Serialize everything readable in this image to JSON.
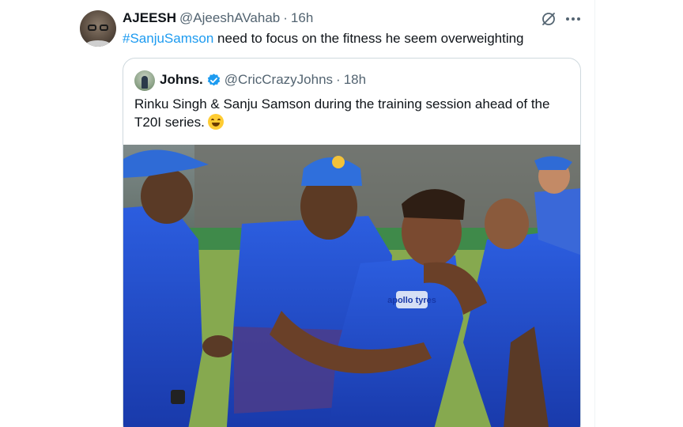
{
  "tweet": {
    "author_name": "AJEESH",
    "author_handle": "@AjeeshAVahab",
    "separator": "·",
    "time": "16h",
    "hashtag": "#SanjuSamson",
    "text": "need to focus on the fitness he seem overweighting"
  },
  "quoted_tweet": {
    "author_name": "Johns.",
    "author_handle": "@CricCrazyJohns",
    "separator": "·",
    "time": "18h",
    "text": "Rinku Singh & Sanju Samson during the training session ahead of the T20I series.",
    "emoji": "grinning-face-emoji",
    "media": {
      "description_icon": "photo-media",
      "jersey_text": "apollo tyres"
    }
  },
  "icons": {
    "grok": "grok-icon",
    "more": "more-options-icon",
    "verified": "verified-badge-icon"
  },
  "colors": {
    "link": "#1d9bf0",
    "secondary_text": "#536471",
    "border": "#cfd9de",
    "verified": "#1d9bf0",
    "jersey_blue": "#1f49c8"
  }
}
